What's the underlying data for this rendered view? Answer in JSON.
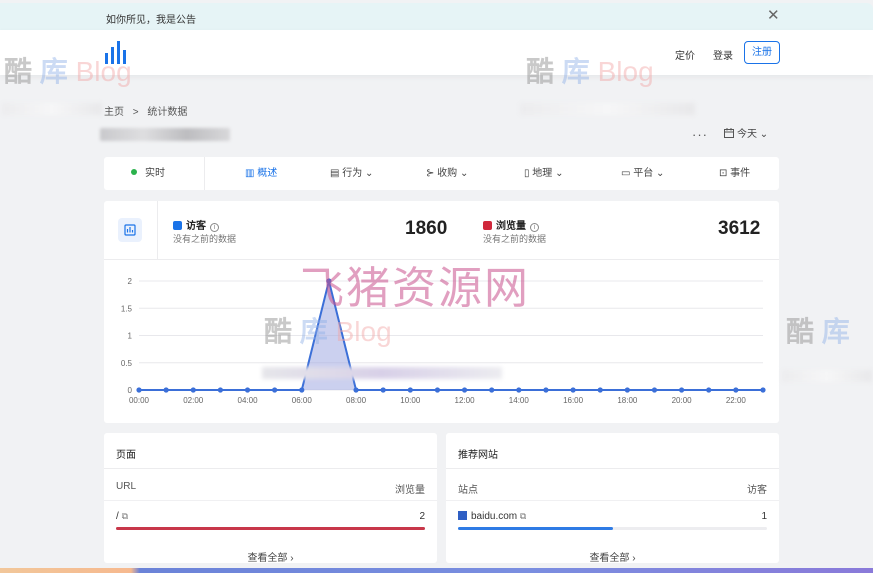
{
  "announcement": {
    "text": "如你所见，我是公告"
  },
  "nav": {
    "pricing": "定价",
    "login": "登录",
    "signup": "注册"
  },
  "breadcrumb": {
    "home": "主页",
    "sep": ">",
    "current": "统计数据"
  },
  "toolbar": {
    "more": "···",
    "date_label": "今天"
  },
  "tabs": [
    {
      "label": "实时"
    },
    {
      "label": "概述"
    },
    {
      "label": "行为"
    },
    {
      "label": "收购"
    },
    {
      "label": "地理"
    },
    {
      "label": "平台"
    },
    {
      "label": "事件"
    }
  ],
  "stats": {
    "visitors": {
      "label": "访客",
      "sub": "没有之前的数据",
      "value": "1860",
      "color": "#1a73e8"
    },
    "pageviews": {
      "label": "浏览量",
      "sub": "没有之前的数据",
      "value": "3612",
      "color": "#d0283c"
    }
  },
  "chart_data": {
    "type": "area",
    "x": [
      "00:00",
      "01:00",
      "02:00",
      "03:00",
      "04:00",
      "05:00",
      "06:00",
      "07:00",
      "08:00",
      "09:00",
      "10:00",
      "11:00",
      "12:00",
      "13:00",
      "14:00",
      "15:00",
      "16:00",
      "17:00",
      "18:00",
      "19:00",
      "20:00",
      "21:00",
      "22:00",
      "23:00"
    ],
    "xticks": [
      "00:00",
      "02:00",
      "04:00",
      "06:00",
      "08:00",
      "10:00",
      "12:00",
      "14:00",
      "16:00",
      "18:00",
      "20:00",
      "22:00"
    ],
    "yticks": [
      "0",
      "0.5",
      "1",
      "1.5",
      "2"
    ],
    "ylim": [
      0,
      2
    ],
    "series": [
      {
        "values": [
          0,
          0,
          0,
          0,
          0,
          0,
          0,
          2,
          0,
          0,
          0,
          0,
          0,
          0,
          0,
          0,
          0,
          0,
          0,
          0,
          0,
          0,
          0,
          0
        ],
        "color": "#3b6fd8"
      }
    ],
    "grid": true
  },
  "pages_panel": {
    "title": "页面",
    "col_left": "URL",
    "col_right": "浏览量",
    "rows": [
      {
        "label": "/",
        "value": "2",
        "fraction": 1.0,
        "color": "#c8374a"
      }
    ],
    "view_all": "查看全部"
  },
  "referrers_panel": {
    "title": "推荐网站",
    "col_left": "站点",
    "col_right": "访客",
    "rows": [
      {
        "label": "baidu.com",
        "value": "1",
        "fraction": 0.5,
        "color": "#2f7be5"
      }
    ],
    "view_all": "查看全部"
  },
  "watermarks": {
    "blog_a": "酷",
    "blog_b": "库",
    "blog_c": "Blog",
    "center": "飞猪资源网"
  }
}
